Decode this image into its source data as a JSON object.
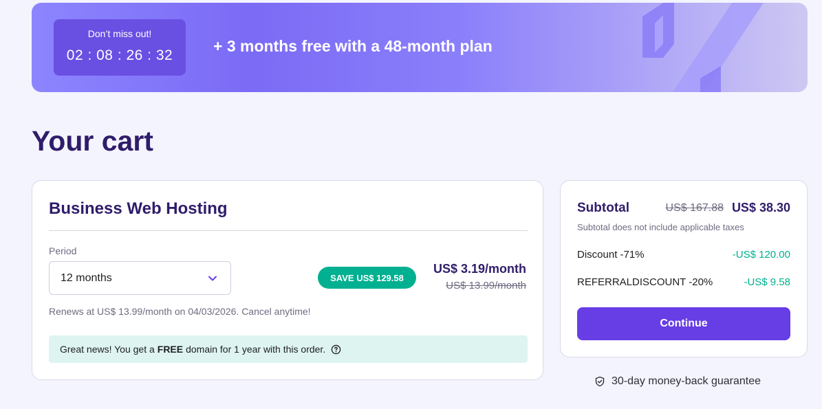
{
  "banner": {
    "countdown_title": "Don’t miss out!",
    "countdown_timer": "02 : 08 : 26 : 32",
    "promo_text": "+ 3 months free with a 48-month plan"
  },
  "page": {
    "title": "Your cart"
  },
  "cart_item": {
    "product_name": "Business Web Hosting",
    "period_label": "Period",
    "period_value": "12 months",
    "save_badge": "SAVE US$ 129.58",
    "price_now": "US$ 3.19/month",
    "price_old": "US$ 13.99/month",
    "renew_note": "Renews at US$ 13.99/month on 04/03/2026. Cancel anytime!",
    "domain_note_prefix": "Great news! You get a",
    "domain_note_bold": "FREE",
    "domain_note_suffix": "domain for 1 year with this order."
  },
  "summary": {
    "subtotal_label": "Subtotal",
    "subtotal_old": "US$ 167.88",
    "subtotal_new": "US$ 38.30",
    "tax_note": "Subtotal does not include applicable taxes",
    "discount_label": "Discount -71%",
    "discount_value": "-US$ 120.00",
    "referral_label": "REFERRALDISCOUNT -20%",
    "referral_value": "-US$ 9.58",
    "continue_label": "Continue"
  },
  "guarantee": {
    "text": "30-day money-back guarantee"
  },
  "icons": {
    "dropdown": "chevron-down-icon",
    "help": "question-circle-icon",
    "guarantee": "shield-check-icon",
    "banner_decoration": "percent-icon"
  },
  "colors": {
    "primary": "#673de6",
    "accent_green": "#00b090",
    "text_dark": "#2f1c6a",
    "page_bg": "#f4f4fe",
    "banner_badge": "#6a4fe3",
    "note_bg": "#def4f0"
  }
}
